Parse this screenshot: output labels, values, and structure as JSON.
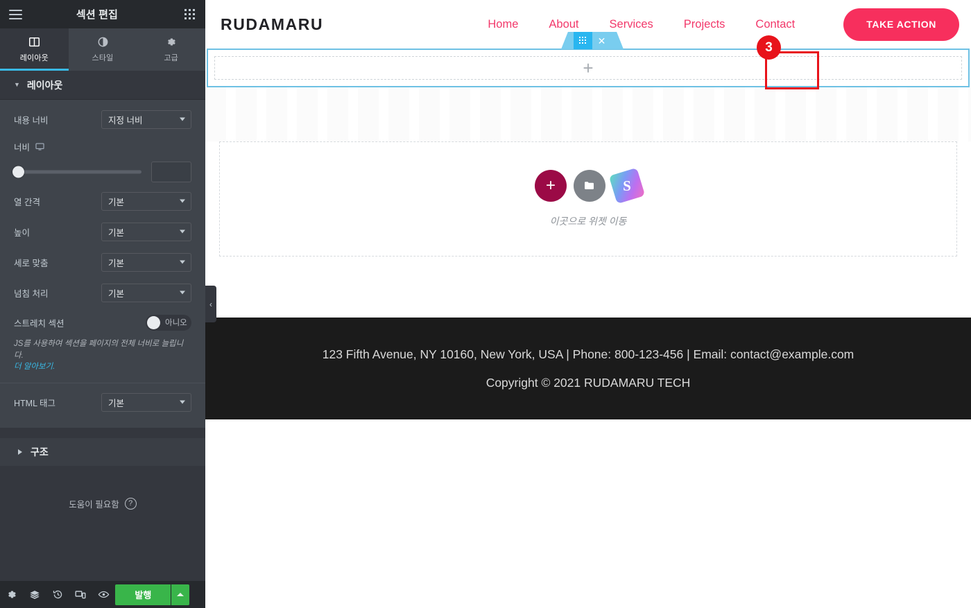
{
  "panel": {
    "header": {
      "title": "섹션 편집",
      "menu_icon": "hamburger-menu-icon",
      "apps_icon": "grid-apps-icon"
    },
    "tabs": [
      {
        "label": "레이아웃",
        "icon": "layout-columns-icon",
        "active": true
      },
      {
        "label": "스타일",
        "icon": "contrast-circle-icon",
        "active": false
      },
      {
        "label": "고급",
        "icon": "gear-icon",
        "active": false
      }
    ],
    "sections": {
      "layout": {
        "title": "레이아웃",
        "expanded": true,
        "controls": [
          {
            "label": "내용 너비",
            "type": "select",
            "value": "지정 너비"
          },
          {
            "label": "너비",
            "type": "slider",
            "device_icon": "desktop-icon",
            "value": "",
            "min_position": 0
          },
          {
            "label": "열 간격",
            "type": "select",
            "value": "기본"
          },
          {
            "label": "높이",
            "type": "select",
            "value": "기본"
          },
          {
            "label": "세로 맞춤",
            "type": "select",
            "value": "기본"
          },
          {
            "label": "넘침 처리",
            "type": "select",
            "value": "기본"
          },
          {
            "label": "스트레치 섹션",
            "type": "switcher",
            "value": "아니오"
          }
        ],
        "stretch_description": "JS를 사용하여 섹션을 페이지의 전체 너비로 늘립니다.",
        "stretch_link": "더 알아보기.",
        "html_tag": {
          "label": "HTML 태그",
          "value": "기본"
        }
      },
      "structure": {
        "title": "구조",
        "expanded": false
      }
    },
    "help": {
      "label": "도움이 필요함",
      "icon": "question-mark-icon"
    },
    "footer": {
      "icons": [
        {
          "name": "settings-gear-icon",
          "glyph": "⚙"
        },
        {
          "name": "navigator-layers-icon",
          "glyph": "☰"
        },
        {
          "name": "history-revisions-icon",
          "glyph": "↺"
        },
        {
          "name": "responsive-mode-icon",
          "glyph": "▭"
        },
        {
          "name": "preview-eye-icon",
          "glyph": "👁"
        }
      ],
      "publish_label": "발행",
      "publish_caret": "publish-options-caret-icon"
    },
    "collapse_tab": {
      "icon": "chevron-left-icon",
      "glyph": "‹"
    }
  },
  "canvas": {
    "site_header": {
      "brand": "RUDAMARU",
      "nav": [
        {
          "label": "Home"
        },
        {
          "label": "About"
        },
        {
          "label": "Services"
        },
        {
          "label": "Projects"
        },
        {
          "label": "Contact"
        }
      ],
      "cta_label": "TAKE ACTION",
      "nav_color": "#f2386a",
      "cta_bg": "#f72f5d"
    },
    "section_handle": {
      "drag_icon": "drag-handle-dots-icon",
      "close_icon": "close-x-icon",
      "color": "#29b6f0"
    },
    "step_badge": {
      "number": "3",
      "color": "#e8131b"
    },
    "edit_section": {
      "add_icon": "add-plus-icon",
      "add_glyph": "+",
      "border_color": "#6ec1e4"
    },
    "drop_zone": {
      "add_icon": "add-widget-plus-icon",
      "add_glyph": "+",
      "folder_icon": "folder-templates-icon",
      "template_icon": "envato-template-kit-icon",
      "template_letter": "S",
      "text": "이곳으로 위젯 이동"
    },
    "site_footer": {
      "line1": "123 Fifth Avenue, NY 10160, New York, USA | Phone: 800-123-456 | Email: contact@example.com",
      "line2": "Copyright © 2021 RUDAMARU TECH",
      "bg": "#1b1b1b"
    }
  }
}
